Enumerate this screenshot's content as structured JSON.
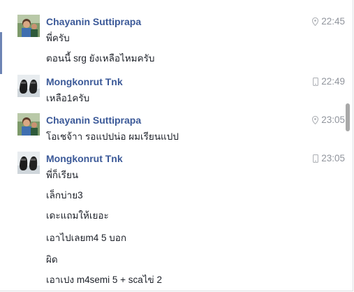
{
  "conversation": {
    "groups": [
      {
        "sender": "Chayanin Suttiprapa",
        "time": "22:45",
        "source_icon": "location-pin-icon",
        "lines": [
          "พี่ครับ",
          "ตอนนี้ srg ยังเหลือไหมครับ"
        ],
        "avatar": "avatar-chayanin"
      },
      {
        "sender": "Mongkonrut Tnk",
        "time": "22:49",
        "source_icon": "mobile-phone-icon",
        "lines": [
          "เหลือ1ครับ"
        ],
        "avatar": "avatar-mongkonrut"
      },
      {
        "sender": "Chayanin Suttiprapa",
        "time": "23:05",
        "source_icon": "location-pin-icon",
        "lines": [
          "โอเชจ้าา รอแปปน่อ ผมเรียนแปป"
        ],
        "avatar": "avatar-chayanin"
      },
      {
        "sender": "Mongkonrut Tnk",
        "time": "23:05",
        "source_icon": "mobile-phone-icon",
        "lines": [
          "พี่ก็เรียน",
          "เล็กบ่าย3",
          "เดะแถมให้เยอะ",
          "เอาไปเลยm4 5 บอก",
          "ผิด",
          "เอาเปง m4semi 5 + scaไข่ 2"
        ],
        "avatar": "avatar-mongkonrut"
      }
    ]
  },
  "colors": {
    "sender_name": "#3b5998",
    "timestamp": "#90949c",
    "message_text": "#1d2129",
    "accent_bar": "#6d84b4"
  }
}
